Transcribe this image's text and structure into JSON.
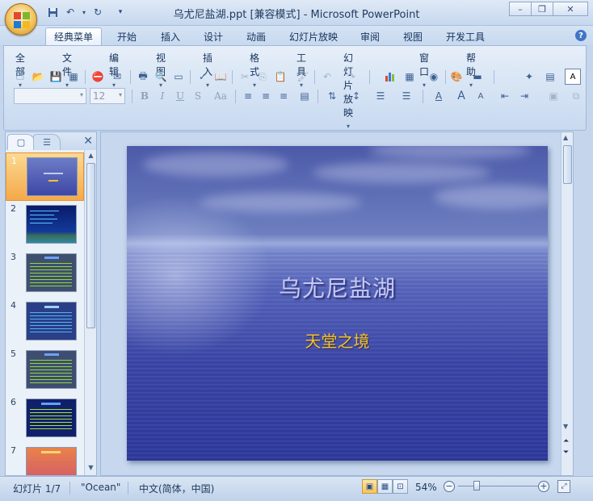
{
  "window": {
    "title": "乌尤尼盐湖.ppt [兼容模式] - Microsoft PowerPoint",
    "minimize_icon": "minimize-icon",
    "maximize_icon": "restore-icon",
    "close_icon": "close-icon"
  },
  "ribbon_tabs": [
    "经典菜单",
    "开始",
    "插入",
    "设计",
    "动画",
    "幻灯片放映",
    "审阅",
    "视图",
    "开发工具"
  ],
  "menus": [
    "全部",
    "文件",
    "编辑",
    "视图",
    "插入",
    "格式",
    "工具",
    "幻灯片放映",
    "窗口",
    "帮助"
  ],
  "font_size": "12",
  "font_name": "",
  "format_buttons": [
    "B",
    "I",
    "U",
    "S",
    "Aa"
  ],
  "slides_pane": {
    "slide_numbers": [
      "1",
      "2",
      "3",
      "4",
      "5",
      "6",
      "7"
    ],
    "selected": "1"
  },
  "slide": {
    "title": "乌尤尼盐湖",
    "subtitle": "天堂之境"
  },
  "status": {
    "slide_info": "幻灯片 1/7",
    "theme": "\"Ocean\"",
    "language": "中文(简体，中国)",
    "zoom": "54%"
  },
  "colors": {
    "accent": "#f4a94a",
    "title_text": "#c5c9f3",
    "subtitle_text": "#f3c230",
    "ribbon_bg": "#d9e6f5"
  }
}
